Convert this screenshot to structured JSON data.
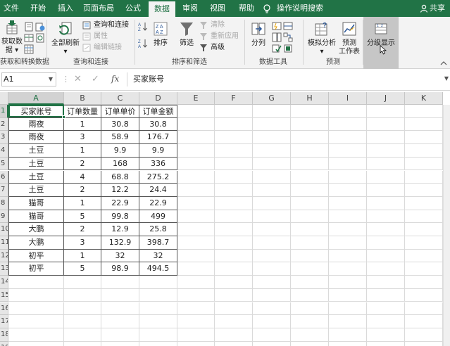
{
  "tabs": [
    {
      "label": "文件",
      "active": false
    },
    {
      "label": "开始",
      "active": false
    },
    {
      "label": "插入",
      "active": false
    },
    {
      "label": "页面布局",
      "active": false
    },
    {
      "label": "公式",
      "active": false
    },
    {
      "label": "数据",
      "active": true
    },
    {
      "label": "审阅",
      "active": false
    },
    {
      "label": "视图",
      "active": false
    },
    {
      "label": "帮助",
      "active": false
    }
  ],
  "tell_me": "操作说明搜索",
  "share": "共享",
  "ribbon": {
    "get_data": {
      "label_line1": "获取数",
      "label_line2": "据 ▾",
      "group": "获取和转换数据"
    },
    "refresh_all": {
      "label_line1": "全部刷新",
      "label_line2": "▾"
    },
    "queries": {
      "item1": "查询和连接",
      "item2": "属性",
      "item3": "编辑链接",
      "group": "查询和连接"
    },
    "sort": {
      "label": "排序"
    },
    "filter": {
      "label": "筛选"
    },
    "filter_opts": {
      "clear": "清除",
      "reapply": "重新应用",
      "advanced": "高级",
      "group": "排序和筛选"
    },
    "text_to_columns": {
      "label": "分列"
    },
    "data_tools_group": "数据工具",
    "what_if": {
      "label_line1": "模拟分析",
      "label_line2": "▾"
    },
    "forecast": {
      "label_line1": "预测",
      "label_line2": "工作表"
    },
    "forecast_group": "预测",
    "outline": {
      "label": "分级显示"
    }
  },
  "formula_bar": {
    "name_box": "A1",
    "fx": "fx",
    "content": "买家账号"
  },
  "grid": {
    "columns": [
      "A",
      "B",
      "C",
      "D",
      "E",
      "F",
      "G",
      "H",
      "I",
      "J",
      "K"
    ],
    "rows": [
      "1",
      "2",
      "3",
      "4",
      "5",
      "6",
      "7",
      "8",
      "9",
      "10",
      "11",
      "12",
      "13",
      "14",
      "15",
      "16",
      "17",
      "18",
      "19"
    ],
    "table": [
      [
        "买家账号",
        "订单数量",
        "订单单价",
        "订单金额"
      ],
      [
        "雨夜",
        "1",
        "30.8",
        "30.8"
      ],
      [
        "雨夜",
        "3",
        "58.9",
        "176.7"
      ],
      [
        "土豆",
        "1",
        "9.9",
        "9.9"
      ],
      [
        "土豆",
        "2",
        "168",
        "336"
      ],
      [
        "土豆",
        "4",
        "68.8",
        "275.2"
      ],
      [
        "土豆",
        "2",
        "12.2",
        "24.4"
      ],
      [
        "猫哥",
        "1",
        "22.9",
        "22.9"
      ],
      [
        "猫哥",
        "5",
        "99.8",
        "499"
      ],
      [
        "大鹏",
        "2",
        "12.9",
        "25.8"
      ],
      [
        "大鹏",
        "3",
        "132.9",
        "398.7"
      ],
      [
        "初平",
        "1",
        "32",
        "32"
      ],
      [
        "初平",
        "5",
        "98.9",
        "494.5"
      ]
    ]
  },
  "colors": {
    "accent": "#217346",
    "ribbon_bg": "#f3f3f3",
    "hover": "#c6c6c6"
  }
}
